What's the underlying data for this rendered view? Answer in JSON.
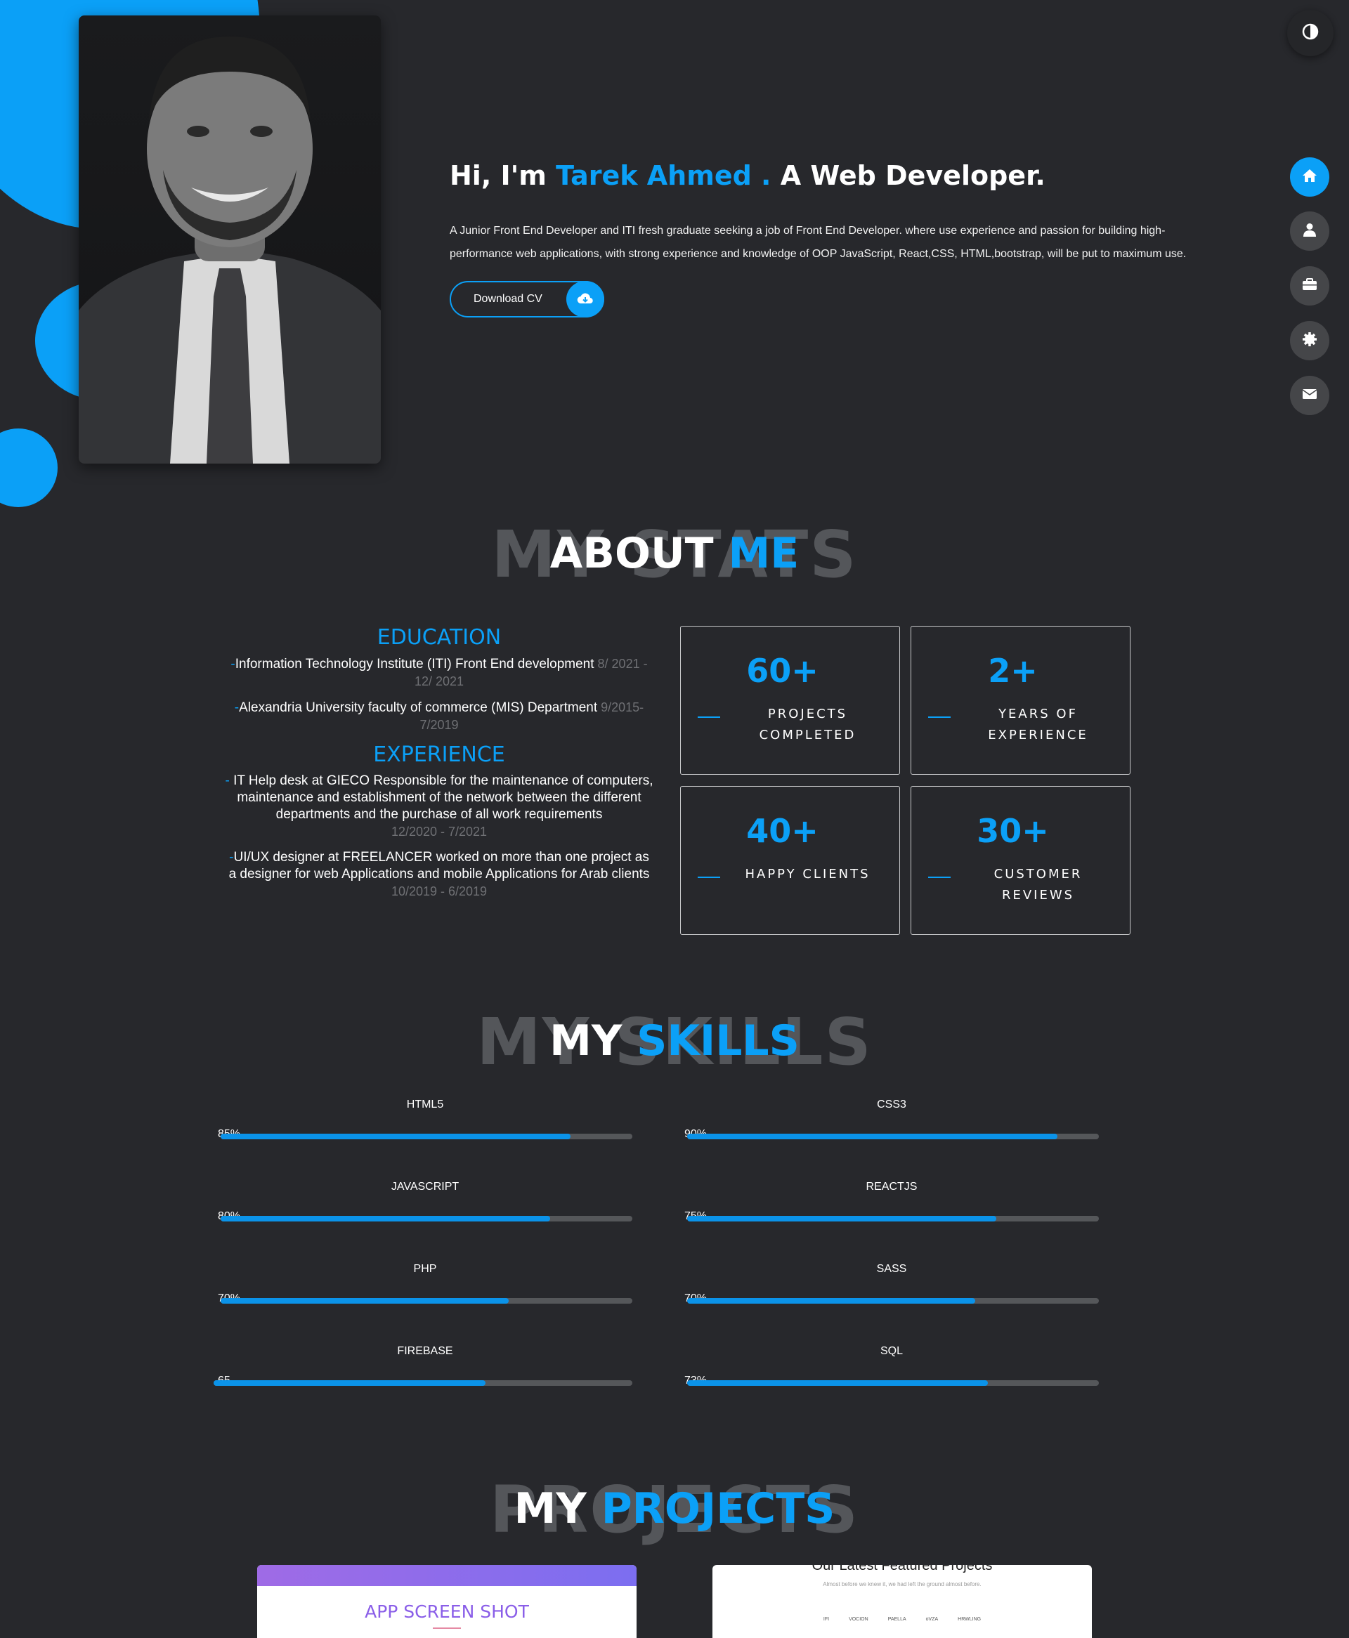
{
  "hero": {
    "greeting": "Hi, I'm ",
    "name": "Tarek Ahmed .",
    "role": " A Web Developer.",
    "description": "A Junior Front End Developer and ITI fresh graduate seeking a job of Front End Developer. where use experience and passion for building high-performance web applications, with strong experience and knowledge of OOP JavaScript, React,CSS, HTML,bootstrap, will be put to maximum use.",
    "download_label": "Download CV",
    "download_icon": "cloud-download-icon"
  },
  "controls": {
    "theme_icon": "contrast-icon",
    "nav": [
      {
        "icon": "home-icon",
        "active": true
      },
      {
        "icon": "user-icon",
        "active": false
      },
      {
        "icon": "briefcase-icon",
        "active": false
      },
      {
        "icon": "gear-icon",
        "active": false
      },
      {
        "icon": "envelope-icon",
        "active": false
      }
    ]
  },
  "about": {
    "bg_title": "MY STATS",
    "title_white": "ABOUT ",
    "title_blue": "ME",
    "education_title": "EDUCATION",
    "education": [
      {
        "dash": "-",
        "text": "Information Technology Institute (ITI) Front End development",
        "date": " 8/ 2021 - 12/ 2021"
      },
      {
        "dash": "-",
        "text": "Alexandria University faculty of commerce (MIS) Department",
        "date": " 9/2015- 7/2019"
      }
    ],
    "experience_title": "EXPERIENCE",
    "experience": [
      {
        "dash": "- ",
        "text": "IT Help desk at GIECO Responsible for the maintenance of computers, maintenance and establishment of the network between the different departments and the purchase of all work requirements",
        "date": "12/2020 - 7/2021"
      },
      {
        "dash": "-",
        "text": "UI/UX designer at FREELANCER worked on more than one project as a designer for web Applications and mobile Applications for Arab clients",
        "date": "10/2019 - 6/2019"
      }
    ],
    "stats": [
      {
        "num": "60+",
        "label": "PROJECTS COMPLETED"
      },
      {
        "num": "2+",
        "label": "YEARS OF EXPERIENCE"
      },
      {
        "num": "40+",
        "label": "HAPPY CLIENTS"
      },
      {
        "num": "30+",
        "label": "CUSTOMER REVIEWS"
      }
    ]
  },
  "skills": {
    "bg_title": "MY SKILLS",
    "title_white": "MY ",
    "title_blue": "SKILLS",
    "items": [
      {
        "name": "HTML5",
        "pct": "85%",
        "value": 0.85
      },
      {
        "name": "CSS3",
        "pct": "90%",
        "value": 0.9
      },
      {
        "name": "JAVASCRIPT",
        "pct": "80%",
        "value": 0.8
      },
      {
        "name": "REACTJS",
        "pct": "75%",
        "value": 0.75
      },
      {
        "name": "PHP",
        "pct": "70%",
        "value": 0.7
      },
      {
        "name": "SASS",
        "pct": "70%",
        "value": 0.7
      },
      {
        "name": "FIREBASE",
        "pct": "65",
        "value": 0.65
      },
      {
        "name": "SQL",
        "pct": "73%",
        "value": 0.73
      }
    ]
  },
  "projects": {
    "bg_title": "PROJECTS",
    "title_white": "MY ",
    "title_blue": "PROJECTS",
    "cards": [
      {
        "title": "APP SCREEN SHOT"
      },
      {
        "title": "Our Latest Featured Projects",
        "subtitle": "Almost before we knew it, we had left the ground almost before.",
        "logos": [
          "IFI",
          "VOCION",
          "PAELLA",
          "oVZA",
          "HRWLING"
        ]
      }
    ]
  },
  "colors": {
    "accent": "#0ba0f7",
    "background": "#27282c",
    "nav_inactive": "#454649"
  }
}
